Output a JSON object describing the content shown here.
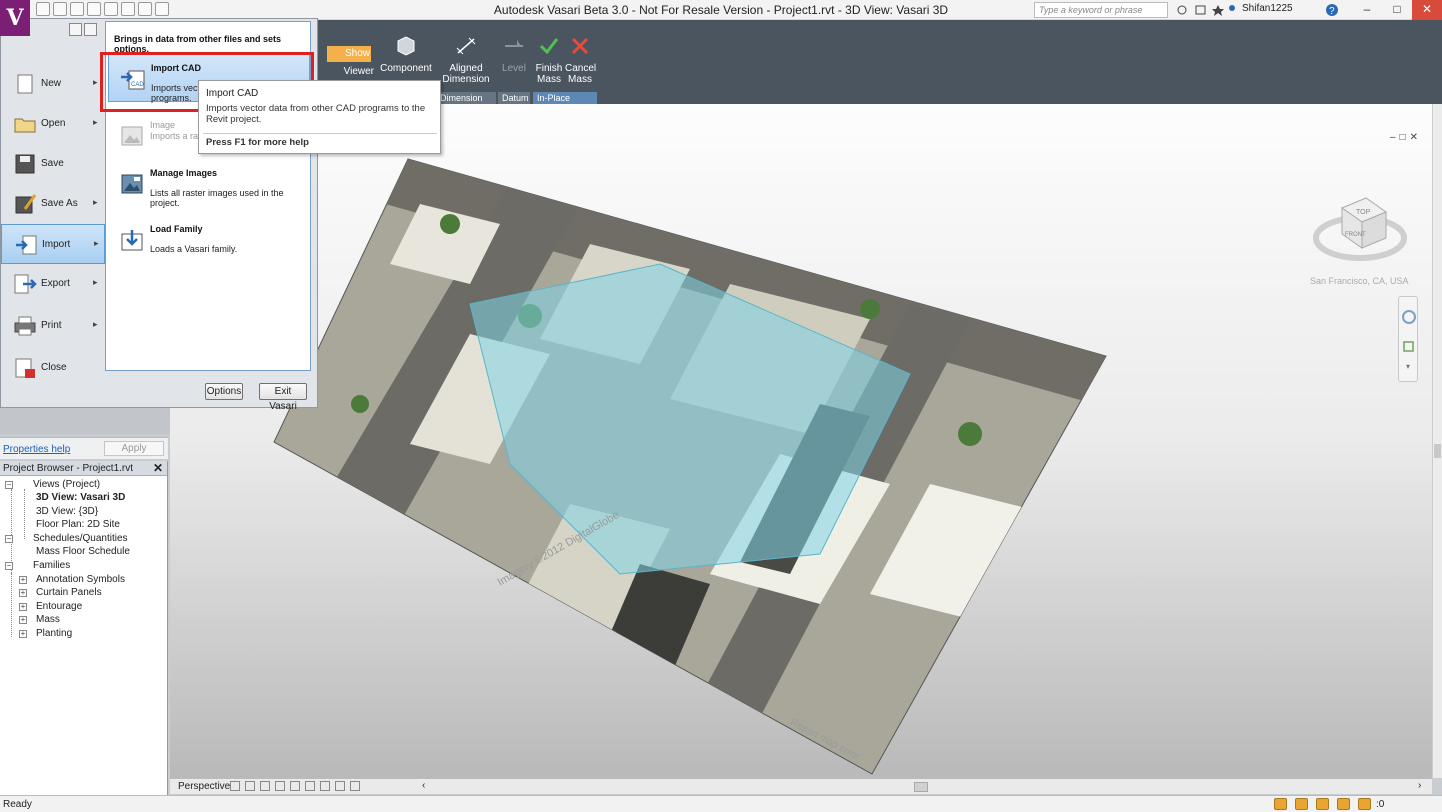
{
  "window": {
    "title": "Autodesk Vasari Beta 3.0 - Not For Resale Version -     Project1.rvt - 3D View: Vasari 3D",
    "search_placeholder": "Type a keyword or phrase",
    "user": "Shifan1225",
    "minimize": "–",
    "maximize": "□",
    "close": "✕"
  },
  "ribbon": {
    "show_label": "Show",
    "viewer_label": "Viewer",
    "component_label": "Component",
    "aligned_dimension_label": "Aligned Dimension",
    "level_label": "Level",
    "finish_mass_label": "Finish Mass",
    "cancel_mass_label": "Cancel Mass",
    "panels": [
      "Dimension",
      "Datum",
      "In-Place Editor"
    ]
  },
  "app_menu": {
    "items": [
      {
        "label": "New",
        "has_arrow": true
      },
      {
        "label": "Open",
        "has_arrow": true
      },
      {
        "label": "Save",
        "has_arrow": false
      },
      {
        "label": "Save As",
        "has_arrow": true
      },
      {
        "label": "Import",
        "has_arrow": true
      },
      {
        "label": "Export",
        "has_arrow": true
      },
      {
        "label": "Print",
        "has_arrow": true
      },
      {
        "label": "Close",
        "has_arrow": false
      }
    ],
    "submenu": {
      "header": "Brings in data from other files and sets options.",
      "items": [
        {
          "title": "Import CAD",
          "desc": "Imports vector data from other CAD programs."
        },
        {
          "title": "Image",
          "desc": "Imports a raster image."
        },
        {
          "title": "Manage Images",
          "desc": "Lists all raster images used in the project."
        },
        {
          "title": "Load Family",
          "desc": "Loads a Vasari family."
        }
      ]
    },
    "options_button": "Options",
    "exit_button": "Exit Vasari"
  },
  "tooltip": {
    "title": "Import CAD",
    "description": "Imports vector data from other CAD programs to the Revit project.",
    "help": "Press F1 for more help"
  },
  "properties": {
    "help_link": "Properties help",
    "apply_button": "Apply"
  },
  "project_browser": {
    "title": "Project Browser - Project1.rvt",
    "close": "✕",
    "tree": [
      {
        "label": "Views (Project)"
      },
      {
        "label": "3D View: Vasari 3D",
        "bold": true
      },
      {
        "label": "3D View: {3D}"
      },
      {
        "label": "Floor Plan: 2D Site"
      },
      {
        "label": "Schedules/Quantities"
      },
      {
        "label": "Mass Floor Schedule"
      },
      {
        "label": "Families"
      },
      {
        "label": "Annotation Symbols"
      },
      {
        "label": "Curtain Panels"
      },
      {
        "label": "Entourage"
      },
      {
        "label": "Mass"
      },
      {
        "label": "Planting"
      }
    ]
  },
  "viewport": {
    "location": "San Francisco, CA, USA",
    "viewcube_top": "TOP",
    "viewcube_front": "FRONT",
    "imagery_credit": "Imagery ©2012 DigitalGlobe",
    "report_text": "Report map error"
  },
  "view_controls": {
    "mode": "Perspective"
  },
  "status": {
    "text": "Ready",
    "filter_count": ":0"
  },
  "colors": {
    "ribbon": "#4a5560",
    "mass_overlay": "#7fd3e6",
    "highlight_red": "#e02020",
    "app_logo": "#7b1f74"
  }
}
